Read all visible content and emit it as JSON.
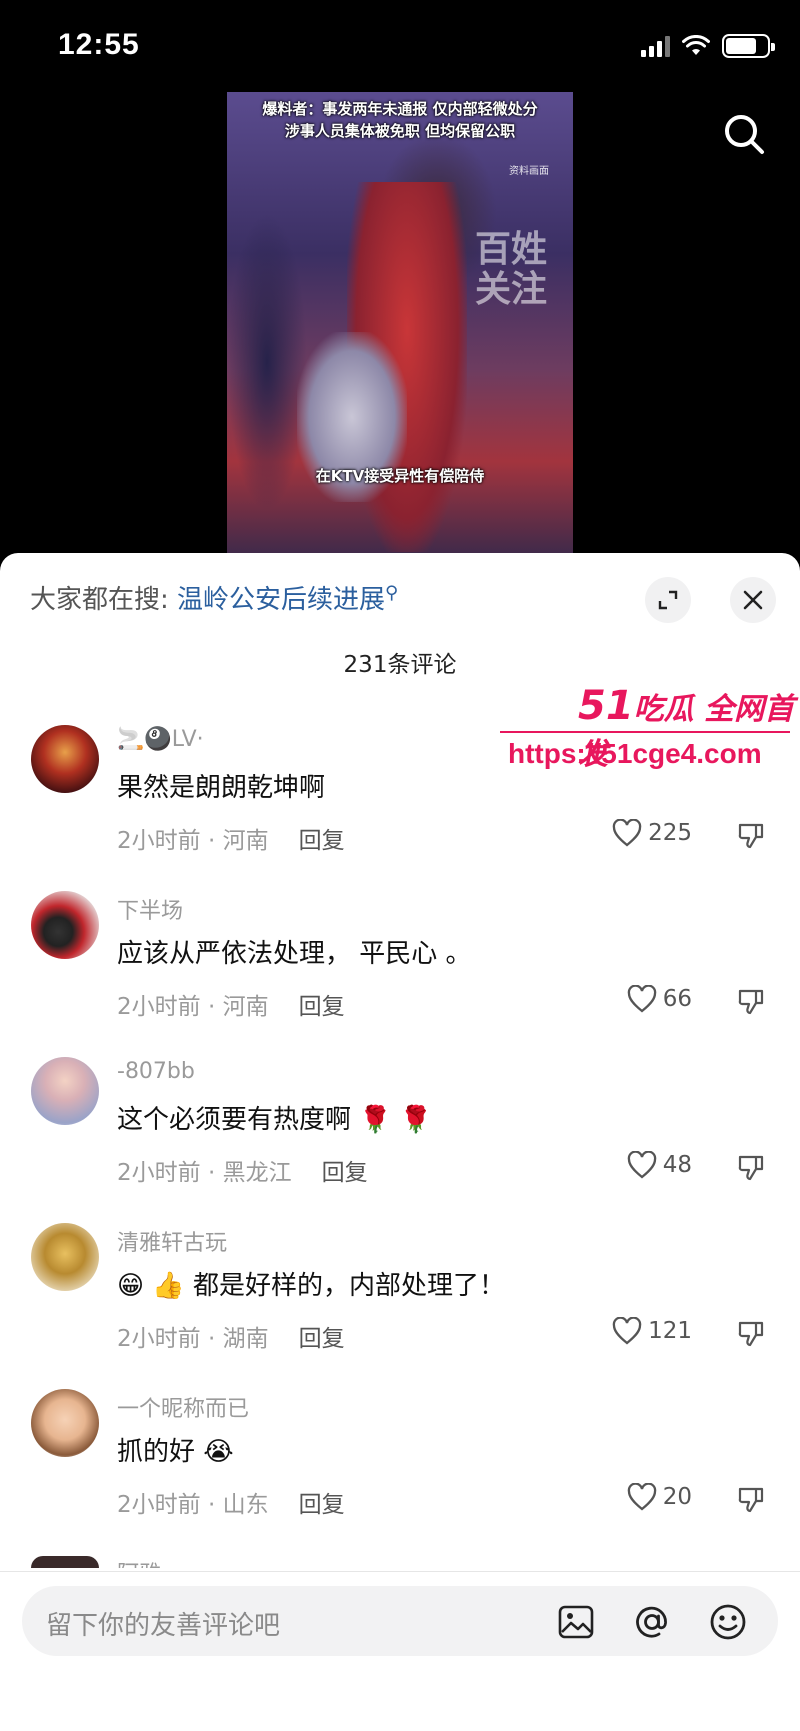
{
  "status_bar": {
    "time": "12:55",
    "battery_level": 0.75
  },
  "video": {
    "caption_line1": "爆料者：事发两年未通报 仅内部轻微处分",
    "caption_line2": "涉事人员集体被免职 但均保留公职",
    "tag": "资料画面",
    "watermark": "百姓关注",
    "subtitle": "在KTV接受异性有偿陪侍"
  },
  "sheet": {
    "hot_search_prefix": "大家都在搜:",
    "hot_search_query": "温岭公安后续进展",
    "comment_count": "231条评论"
  },
  "promo": {
    "title_num": "51",
    "title_text": "吃瓜 全网首发",
    "url": "https://51cge4.com"
  },
  "comments": [
    {
      "username": "🚬🎱LV·",
      "text": "果然是朗朗乾坤啊",
      "time": "2小时前",
      "location": "河南",
      "reply": "回复",
      "likes": "225"
    },
    {
      "username": "下半场",
      "text": "应该从严依法处理， 平民心 。",
      "time": "2小时前",
      "location": "河南",
      "reply": "回复",
      "likes": "66"
    },
    {
      "username": "-807bb",
      "text": "这个必须要有热度啊 🌹 🌹",
      "time": "2小时前",
      "location": "黑龙江",
      "reply": "回复",
      "likes": "48"
    },
    {
      "username": "清雅轩古玩",
      "text": "😁 👍 都是好样的，内部处理了！",
      "time": "2小时前",
      "location": "湖南",
      "reply": "回复",
      "likes": "121"
    },
    {
      "username": "一个昵称而已",
      "text": "抓的好 😭",
      "time": "2小时前",
      "location": "山东",
      "reply": "回复",
      "likes": "20"
    }
  ],
  "partial_comment": {
    "username": "阿雅"
  },
  "input": {
    "placeholder": "留下你的友善评论吧"
  },
  "icons": [
    "search-icon",
    "expand-icon",
    "close-icon",
    "heart-icon",
    "dislike-icon",
    "image-icon",
    "at-icon",
    "emoji-icon"
  ]
}
